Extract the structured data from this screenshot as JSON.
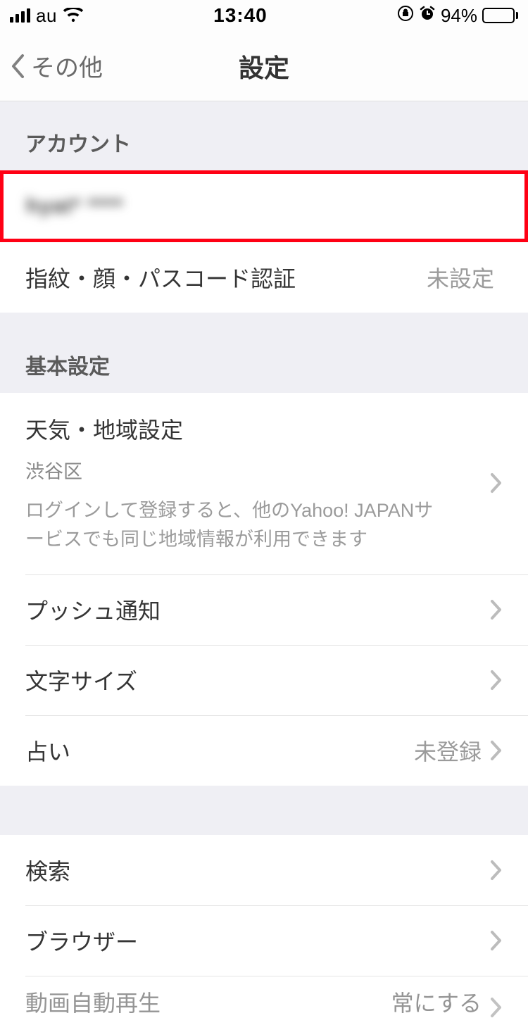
{
  "status": {
    "carrier": "au",
    "time": "13:40",
    "battery_pct": "94%"
  },
  "nav": {
    "back_label": "その他",
    "title": "設定"
  },
  "sections": {
    "account_header": "アカウント",
    "basic_header": "基本設定"
  },
  "account": {
    "id_obscured": "hyat* ****",
    "auth_label": "指紋・顔・パスコード認証",
    "auth_value": "未設定"
  },
  "weather": {
    "title": "天気・地域設定",
    "region": "渋谷区",
    "hint": "ログインして登録すると、他のYahoo! JAPANサービスでも同じ地域情報が利用できます"
  },
  "rows": {
    "push": "プッシュ通知",
    "font_size": "文字サイズ",
    "fortune_label": "占い",
    "fortune_value": "未登録",
    "search": "検索",
    "browser": "ブラウザー",
    "video_label": "動画自動再生",
    "video_value": "常にする"
  }
}
